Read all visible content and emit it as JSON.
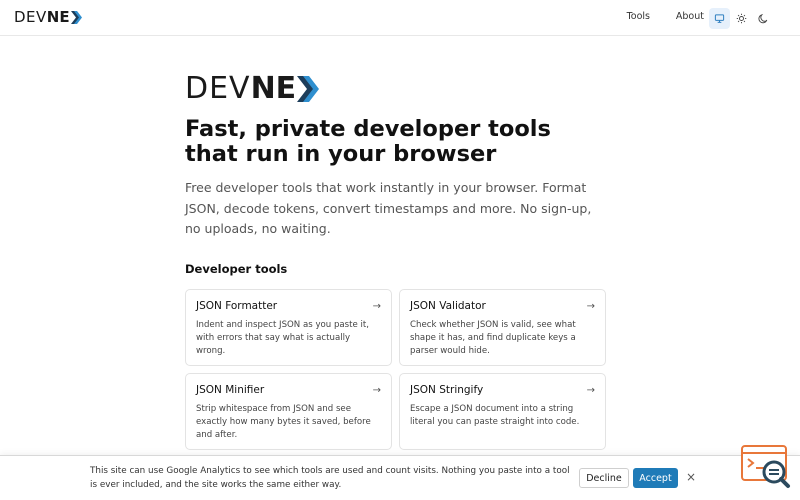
{
  "header": {
    "logo_light": "DEV",
    "logo_bold": "NE",
    "nav": {
      "tools": "Tools",
      "about": "About"
    },
    "theme_options": [
      "system",
      "light",
      "dark"
    ],
    "theme_active": "system"
  },
  "hero": {
    "logo_light": "DEV",
    "logo_bold": "NE",
    "title": "Fast, private developer tools that run in your browser",
    "subtitle": "Free developer tools that work instantly in your browser. Format JSON, decode tokens, convert timestamps and more. No sign-up, no uploads, no waiting."
  },
  "tools_section": {
    "title": "Developer tools",
    "items": [
      {
        "title": "JSON Formatter",
        "desc": "Indent and inspect JSON as you paste it, with errors that say what is actually wrong."
      },
      {
        "title": "JSON Validator",
        "desc": "Check whether JSON is valid, see what shape it has, and find duplicate keys a parser would hide."
      },
      {
        "title": "JSON Minifier",
        "desc": "Strip whitespace from JSON and see exactly how many bytes it saved, before and after."
      },
      {
        "title": "JSON Stringify",
        "desc": "Escape a JSON document into a string literal you can paste straight into code."
      }
    ]
  },
  "consent": {
    "text": "This site can use Google Analytics to see which tools are used and count visits. Nothing you paste into a tool is ever included, and the site works the same either way.",
    "decline": "Decline",
    "accept": "Accept",
    "close": "×"
  },
  "colors": {
    "accent": "#1f7bb8",
    "logo_chevron_dark": "#1c3d5a",
    "logo_chevron_light": "#2f8fcf",
    "theme_active_bg": "#e6f0fb",
    "widget_orange": "#e8773a"
  }
}
